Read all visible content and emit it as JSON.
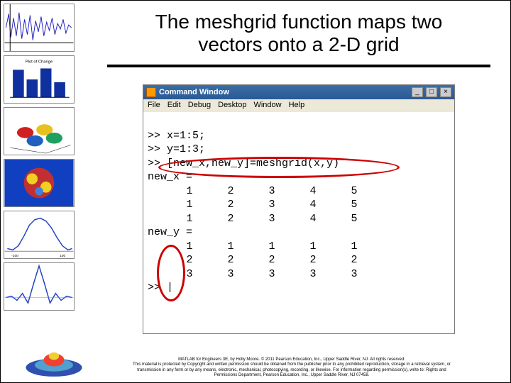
{
  "title_line1": "The meshgrid function maps two",
  "title_line2": "vectors onto a 2-D grid",
  "cmdwin": {
    "title": "Command Window",
    "menus": [
      "File",
      "Edit",
      "Debug",
      "Desktop",
      "Window",
      "Help"
    ],
    "btn_min": "_",
    "btn_max": "□",
    "btn_close": "×"
  },
  "code": {
    "l1": ">> x=1:5;",
    "l2": ">> y=1:3;",
    "l3": ">> [new_x,new_y]=meshgrid(x,y)",
    "nx_label": "new_x =",
    "nx": [
      [
        "1",
        "2",
        "3",
        "4",
        "5"
      ],
      [
        "1",
        "2",
        "3",
        "4",
        "5"
      ],
      [
        "1",
        "2",
        "3",
        "4",
        "5"
      ]
    ],
    "ny_label": "new_y =",
    "ny": [
      [
        "1",
        "1",
        "1",
        "1",
        "1"
      ],
      [
        "2",
        "2",
        "2",
        "2",
        "2"
      ],
      [
        "3",
        "3",
        "3",
        "3",
        "3"
      ]
    ],
    "prompt": ">> |"
  },
  "footer": {
    "l1": "MATLAB for Engineers 3E, by Holly Moore. © 2011 Pearson Education, Inc., Upper Saddle River, NJ. All rights reserved.",
    "l2": "This material is protected by Copyright and written permission should be obtained from the publisher prior to any prohibited reproduction, storage in a retrieval system, or",
    "l3": "transmission in any form or by any means, electronic, mechanical, photocopying, recording, or likewise. For information regarding permission(s), write to: Rights and",
    "l4": "Permissions Department, Pearson Education, Inc., Upper Saddle River, NJ 07458."
  }
}
